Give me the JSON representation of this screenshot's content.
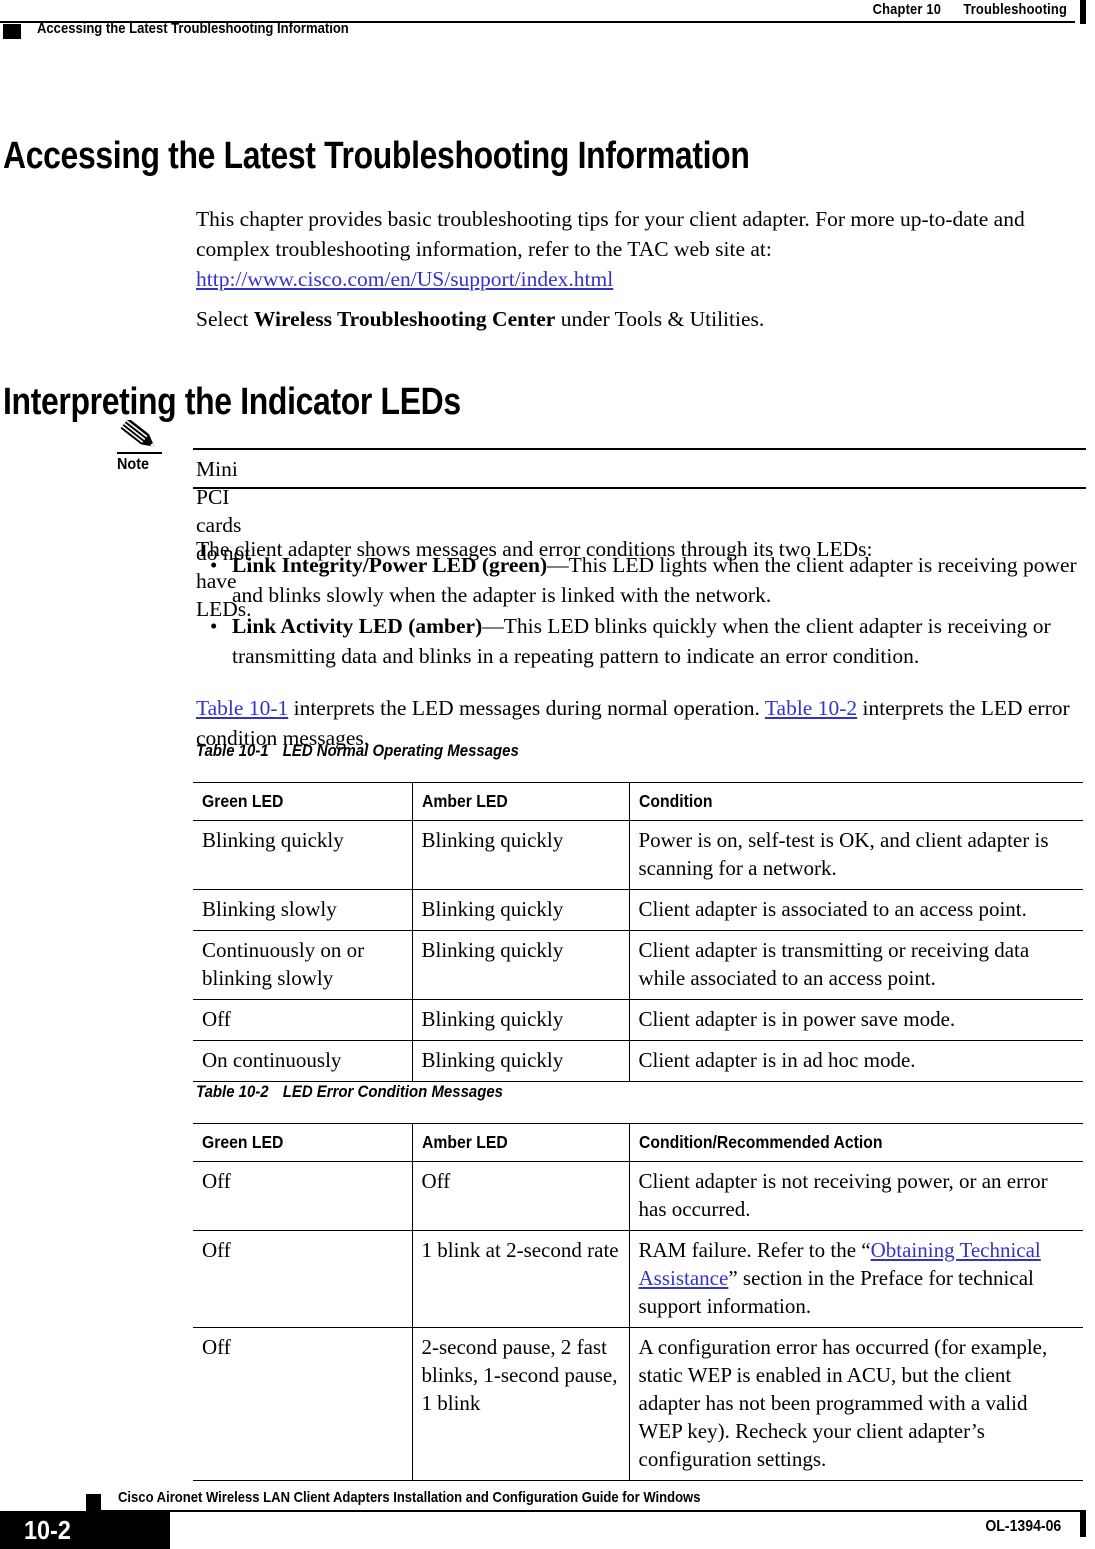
{
  "header": {
    "chapter_label": "Chapter 10",
    "chapter_title": "Troubleshooting",
    "section_title": "Accessing the Latest Troubleshooting Information"
  },
  "colors": {
    "link": "#3333CC",
    "text": "#000000",
    "rule": "#000000"
  },
  "sections": {
    "heading1": "Accessing the Latest Troubleshooting Information",
    "intro_paragraph": "This chapter provides basic troubleshooting tips for your client adapter. For more up-to-date and complex troubleshooting information, refer to the TAC web site at:",
    "url": "http://www.cisco.com/en/US/support/index.html",
    "select_prefix": "Select ",
    "select_bold": "Wireless Troubleshooting Center",
    "select_suffix": " under Tools & Utilities.",
    "heading2": "Interpreting the Indicator LEDs"
  },
  "note": {
    "icon": "pencil-note-icon",
    "label": "Note",
    "text": "Mini PCI cards do not have LEDs."
  },
  "leds": {
    "lead_in": "The client adapter shows messages and error conditions through its two LEDs:",
    "bullet_char": "•",
    "bullets": [
      {
        "bold": "Link Integrity/Power LED (green)",
        "rest": "—This LED lights when the client adapter is receiving power and blinks slowly when the adapter is linked with the network."
      },
      {
        "bold": "Link Activity LED (amber)",
        "rest": "—This LED blinks quickly when the client adapter is receiving or transmitting data and blinks in a repeating pattern to indicate an error condition."
      }
    ],
    "xref_paragraph": {
      "link1": "Table 10-1",
      "mid": " interprets the LED messages during normal operation. ",
      "link2": "Table 10-2",
      "tail": " interprets the LED error condition messages."
    }
  },
  "table1": {
    "caption_number": "Table 10-1",
    "caption_title": "LED Normal Operating Messages",
    "columns": [
      "Green LED",
      "Amber LED",
      "Condition"
    ],
    "rows": [
      [
        "Blinking quickly",
        "Blinking quickly",
        "Power is on, self-test is OK, and client adapter is scanning for a network."
      ],
      [
        "Blinking slowly",
        "Blinking quickly",
        "Client adapter is associated to an access point."
      ],
      [
        "Continuously on or blinking slowly",
        "Blinking quickly",
        "Client adapter is transmitting or receiving data while associated to an access point."
      ],
      [
        "Off",
        "Blinking quickly",
        "Client adapter is in power save mode."
      ],
      [
        "On continuously",
        "Blinking quickly",
        "Client adapter is in ad hoc mode."
      ]
    ]
  },
  "table2": {
    "caption_number": "Table 10-2",
    "caption_title": "LED Error Condition Messages",
    "columns": [
      "Green LED",
      "Amber LED",
      "Condition/Recommended Action"
    ],
    "rows": [
      {
        "green": "Off",
        "amber": "Off",
        "condition_pre": "Client adapter is not receiving power, or an error has occurred.",
        "condition_link": "",
        "condition_post": ""
      },
      {
        "green": "Off",
        "amber": "1 blink at 2-second rate",
        "condition_pre": "RAM failure. Refer to the “",
        "condition_link": "Obtaining Technical Assistance",
        "condition_post": "” section in the Preface for technical support information."
      },
      {
        "green": "Off",
        "amber": "2-second pause, 2 fast blinks, 1-second pause, 1 blink",
        "condition_pre": "A configuration error has occurred (for example, static WEP is enabled in ACU, but the client adapter has not been programmed with a valid WEP key). Recheck your client adapter’s configuration settings.",
        "condition_link": "",
        "condition_post": ""
      }
    ]
  },
  "footer": {
    "guide_title": "Cisco Aironet Wireless LAN Client Adapters Installation and Configuration Guide for Windows",
    "page_number": "10-2",
    "doc_id": "OL-1394-06"
  }
}
